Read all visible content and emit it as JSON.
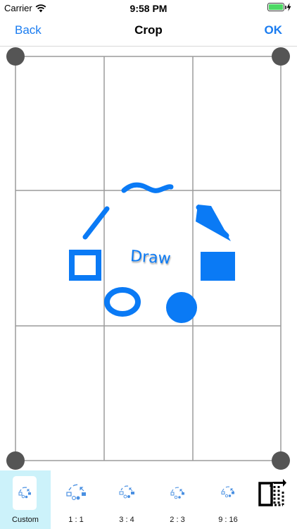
{
  "status_bar": {
    "carrier": "Carrier",
    "time": "9:58 PM",
    "battery_level": 1.0,
    "battery_color": "#4cd964"
  },
  "nav": {
    "back_label": "Back",
    "title": "Crop",
    "ok_label": "OK"
  },
  "canvas": {
    "drawing_text": "Draw",
    "accent_color": "#0a7af5",
    "grid_color": "#9b9b9b",
    "handle_color": "#555555"
  },
  "toolbar": {
    "ratios": [
      {
        "label": "Custom",
        "selected": true
      },
      {
        "label": "1 : 1",
        "selected": false
      },
      {
        "label": "3 : 4",
        "selected": false
      },
      {
        "label": "2 : 3",
        "selected": false
      },
      {
        "label": "9 : 16",
        "selected": false
      }
    ],
    "rotate_icon": "rotate-orientation-icon",
    "selected_color": "#ccf2fa"
  }
}
